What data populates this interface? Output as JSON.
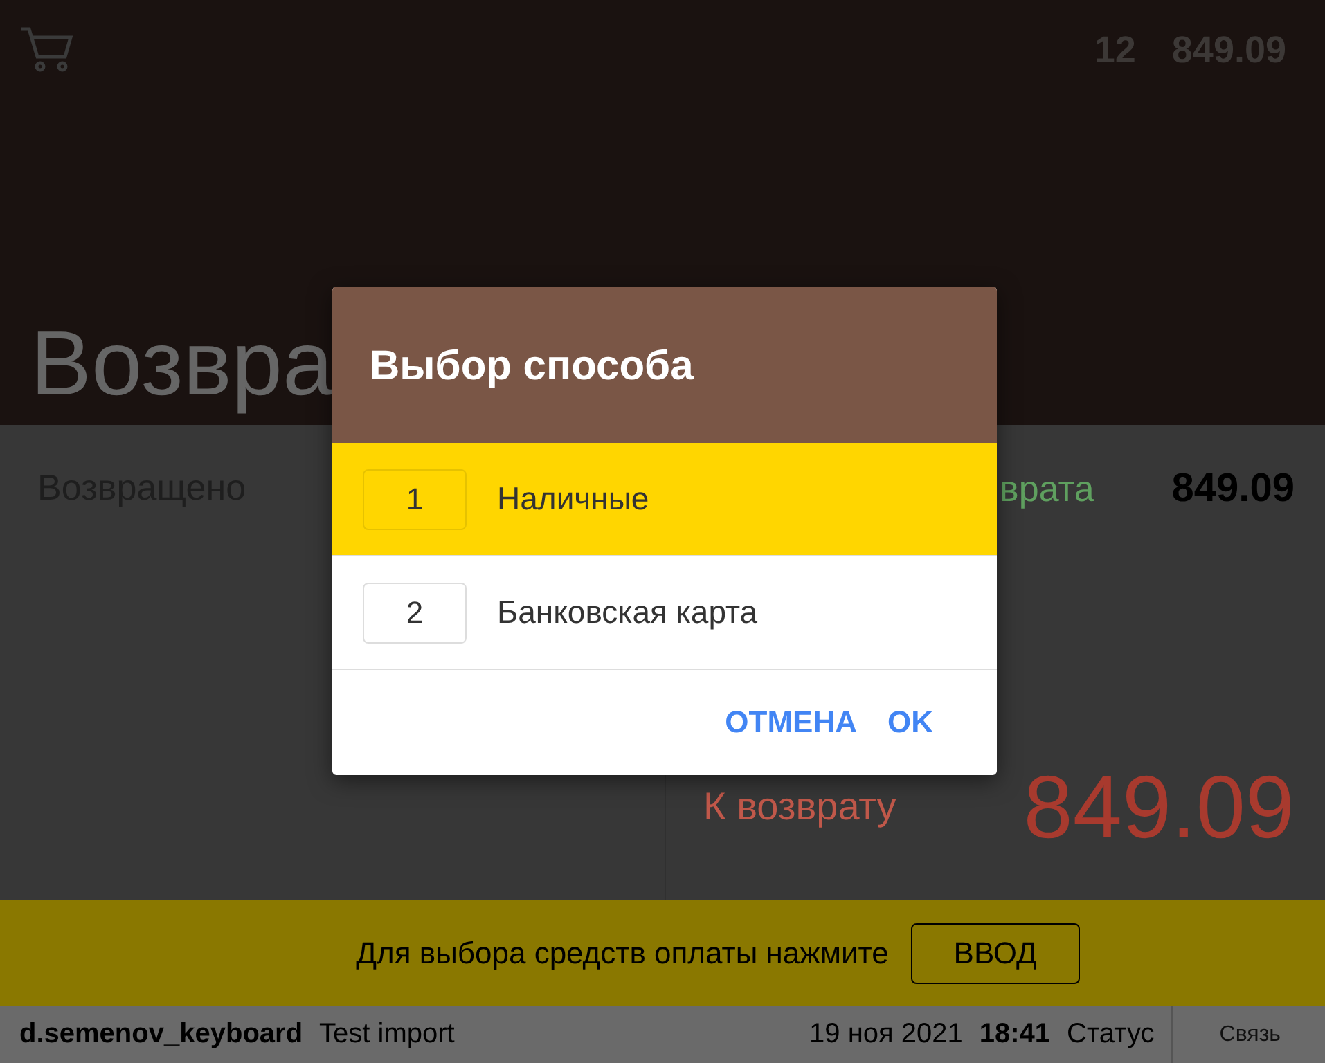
{
  "header": {
    "cart_count": "12",
    "cart_total": "849.09",
    "title": "Возвра"
  },
  "summary": {
    "returned_label": "Возвращено",
    "refund_label_fragment": "врата",
    "refund_sum": "849.09",
    "due_label": "К возврату",
    "due_amount": "849.09"
  },
  "prompt": {
    "text": "Для выбора средств оплаты нажмите",
    "button": "ВВОД"
  },
  "status_bar": {
    "user": "d.semenov_keyboard",
    "company": "Test import",
    "date": "19 ноя 2021",
    "time": "18:41",
    "status": "Статус",
    "connection": "Связь"
  },
  "dialog": {
    "title": "Выбор способа",
    "methods": [
      {
        "key": "1",
        "label": "Наличные",
        "selected": true
      },
      {
        "key": "2",
        "label": "Банковская карта",
        "selected": false
      }
    ],
    "buttons": [
      "ОТМЕНА",
      "OK"
    ]
  }
}
